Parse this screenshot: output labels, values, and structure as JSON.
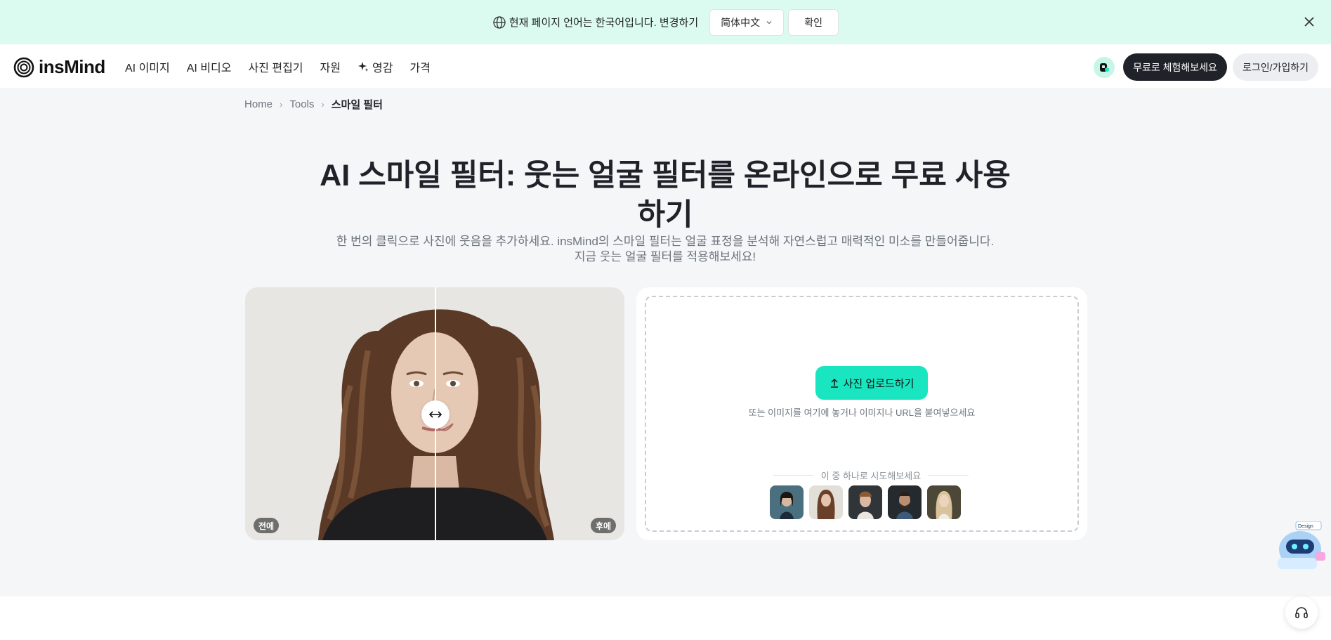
{
  "language_bar": {
    "message": "현재 페이지 언어는 한국어입니다. 변경하기",
    "selected_language": "简体中文",
    "confirm_label": "확인",
    "icons": [
      "globe-icon",
      "chevron-down-icon",
      "close-icon"
    ]
  },
  "header": {
    "logo_text": "insMind",
    "nav": [
      "AI 이미지",
      "AI 비디오",
      "사진 편집기",
      "자원",
      "영감",
      "가격"
    ],
    "inspiration_icon": "sparkle-icon",
    "try_free_label": "무료로 체험해보세요",
    "login_label": "로그인/가입하기"
  },
  "breadcrumb": {
    "items": [
      "Home",
      "Tools"
    ],
    "current": "스마일 필터"
  },
  "hero": {
    "title": "AI 스마일 필터: 웃는 얼굴 필터를 온라인으로 무료 사용하기",
    "subtitle_line1": "한 번의 클릭으로 사진에 웃음을 추가하세요. insMind의 스마일 필터는 얼굴 표정을 분석해 자연스럽고 매력적인 미소를 만들어줍니다.",
    "subtitle_line2": "지금 웃는 얼굴 필터를 적용해보세요!"
  },
  "compare": {
    "before_label": "전에",
    "after_label": "후에",
    "handle_icon": "left-right-arrow-icon"
  },
  "upload": {
    "button_label": "사진 업로드하기",
    "hint": "또는 이미지를 여기에 놓거나 이미지나 URL을 붙여넣으세요",
    "try_label": "이 중 하나로 시도해보세요",
    "sample_count": 5
  },
  "floating": {
    "bot_label": "Design",
    "support_icon": "headset-icon"
  },
  "colors": {
    "banner_bg": "#dbfaf0",
    "accent": "#19e6c1",
    "dark_button": "#1f2329"
  }
}
